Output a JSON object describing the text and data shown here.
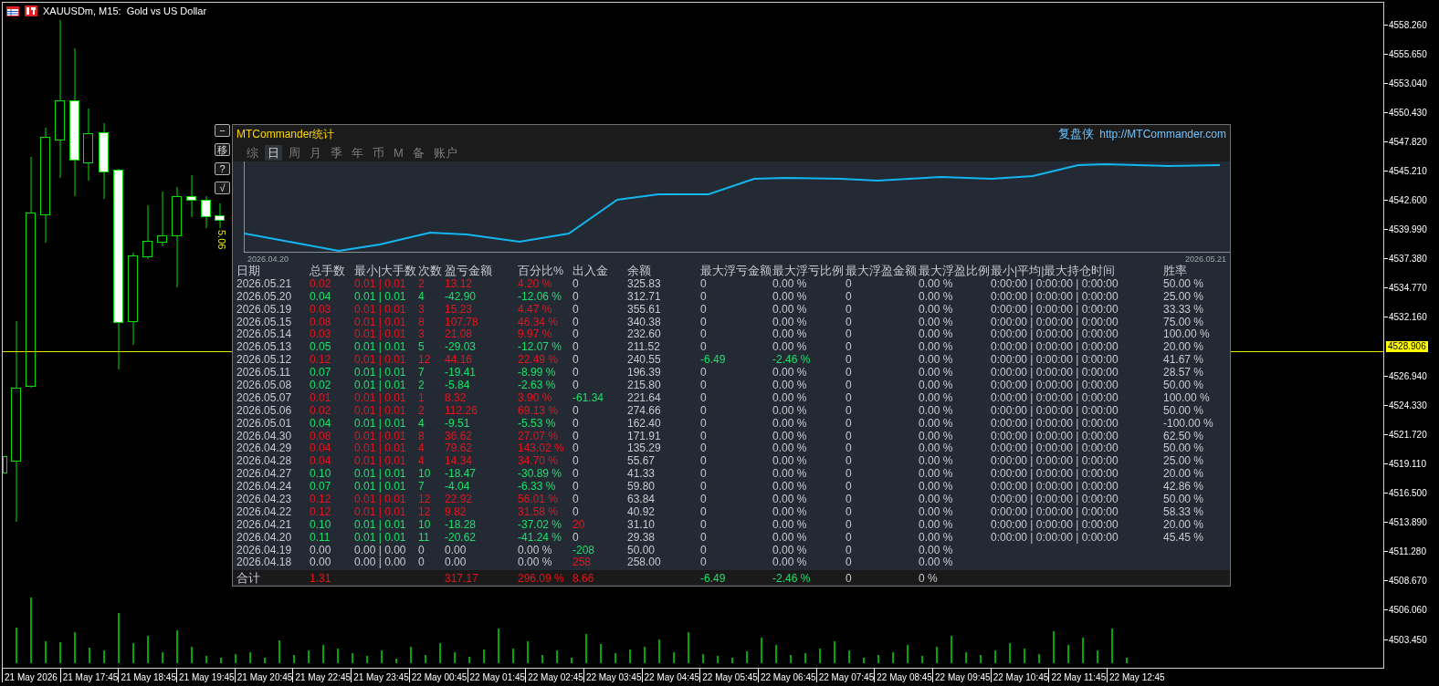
{
  "chart_header": {
    "title": "XAUUSDm, M15:  Gold vs US Dollar"
  },
  "price_marker": "5.06",
  "price_axis": {
    "labels_above": [
      "4558.260",
      "4555.650",
      "4553.040",
      "4550.430",
      "4547.820",
      "4545.210",
      "4542.600",
      "4539.990",
      "4537.380",
      "4534.770",
      "4532.160"
    ],
    "current_price": "4528.906",
    "labels_below": [
      "4526.940",
      "4524.330",
      "4521.720",
      "4519.110",
      "4516.500",
      "4513.890",
      "4511.280",
      "4508.670",
      "4506.060",
      "4503.450"
    ]
  },
  "time_axis": {
    "labels": [
      "21 May 2026",
      "21 May 17:45",
      "21 May 18:45",
      "21 May 19:45",
      "21 May 20:45",
      "21 May 22:45",
      "21 May 23:45",
      "22 May 00:45",
      "22 May 01:45",
      "22 May 02:45",
      "22 May 03:45",
      "22 May 04:45",
      "22 May 05:45",
      "22 May 06:45",
      "22 May 07:45",
      "22 May 08:45",
      "22 May 09:45",
      "22 May 10:45",
      "22 May 11:45",
      "22 May 12:45"
    ]
  },
  "stats_panel": {
    "side_buttons": [
      "−",
      "移",
      "?",
      "√"
    ],
    "title": "MTCommander统计",
    "brand": "复盘侠",
    "link": "http://MTCommander.com",
    "tabs": [
      {
        "label": "综",
        "selected": false
      },
      {
        "label": "日",
        "selected": true
      },
      {
        "label": "周",
        "selected": false
      },
      {
        "label": "月",
        "selected": false
      },
      {
        "label": "季",
        "selected": false
      },
      {
        "label": "年",
        "selected": false
      },
      {
        "label": "币",
        "selected": false
      },
      {
        "label": "M",
        "selected": false
      },
      {
        "label": "备",
        "selected": false
      },
      {
        "label": "账户",
        "selected": false
      }
    ],
    "equity_chart": {
      "start_date": "2026.04.20",
      "end_date": "2026.05.21"
    },
    "table": {
      "columns": [
        "日期",
        "总手数",
        "最小|大手数",
        "次数",
        "盈亏金额",
        "百分比%",
        "出入金",
        "余额",
        "最大浮亏金额",
        "最大浮亏比例",
        "最大浮盈金额",
        "最大浮盈比例",
        "最小|平均|最大持仓时间",
        "胜率"
      ],
      "rows": [
        {
          "cells": [
            "2026.05.21",
            {
              "text": "0.02",
              "color": "#e3161e"
            },
            {
              "text": "0.01 | 0.01",
              "color": "#e3161e"
            },
            {
              "text": "2",
              "color": "#e3161e"
            },
            {
              "text": "13.12",
              "color": "#e3161e"
            },
            {
              "text": "4.20 %",
              "color": "#e3161e"
            },
            "0",
            "325.83",
            "0",
            "0.00 %",
            "0",
            "0.00 %",
            "0:00:00 | 0:00:00 | 0:00:00",
            "50.00 %"
          ]
        },
        {
          "cells": [
            "2026.05.20",
            {
              "text": "0.04",
              "color": "#1fe06c"
            },
            {
              "text": "0.01 | 0.01",
              "color": "#1fe06c"
            },
            {
              "text": "4",
              "color": "#1fe06c"
            },
            {
              "text": "-42.90",
              "color": "#1fe06c"
            },
            {
              "text": "-12.06 %",
              "color": "#1fe06c"
            },
            "0",
            "312.71",
            "0",
            "0.00 %",
            "0",
            "0.00 %",
            "0:00:00 | 0:00:00 | 0:00:00",
            "25.00 %"
          ]
        },
        {
          "cells": [
            "2026.05.19",
            {
              "text": "0.03",
              "color": "#e3161e"
            },
            {
              "text": "0.01 | 0.01",
              "color": "#e3161e"
            },
            {
              "text": "3",
              "color": "#e3161e"
            },
            {
              "text": "15.23",
              "color": "#e3161e"
            },
            {
              "text": "4.47 %",
              "color": "#e3161e"
            },
            "0",
            "355.61",
            "0",
            "0.00 %",
            "0",
            "0.00 %",
            "0:00:00 | 0:00:00 | 0:00:00",
            "33.33 %"
          ]
        },
        {
          "cells": [
            "2026.05.15",
            {
              "text": "0.08",
              "color": "#e3161e"
            },
            {
              "text": "0.01 | 0.01",
              "color": "#e3161e"
            },
            {
              "text": "8",
              "color": "#e3161e"
            },
            {
              "text": "107.78",
              "color": "#e3161e"
            },
            {
              "text": "46.34 %",
              "color": "#e3161e"
            },
            "0",
            "340.38",
            "0",
            "0.00 %",
            "0",
            "0.00 %",
            "0:00:00 | 0:00:00 | 0:00:00",
            "75.00 %"
          ]
        },
        {
          "cells": [
            "2026.05.14",
            {
              "text": "0.03",
              "color": "#e3161e"
            },
            {
              "text": "0.01 | 0.01",
              "color": "#e3161e"
            },
            {
              "text": "3",
              "color": "#e3161e"
            },
            {
              "text": "21.08",
              "color": "#e3161e"
            },
            {
              "text": "9.97 %",
              "color": "#e3161e"
            },
            "0",
            "232.60",
            "0",
            "0.00 %",
            "0",
            "0.00 %",
            "0:00:00 | 0:00:00 | 0:00:00",
            "100.00 %"
          ]
        },
        {
          "cells": [
            "2026.05.13",
            {
              "text": "0.05",
              "color": "#1fe06c"
            },
            {
              "text": "0.01 | 0.01",
              "color": "#1fe06c"
            },
            {
              "text": "5",
              "color": "#1fe06c"
            },
            {
              "text": "-29.03",
              "color": "#1fe06c"
            },
            {
              "text": "-12.07 %",
              "color": "#1fe06c"
            },
            "0",
            "211.52",
            "0",
            "0.00 %",
            "0",
            "0.00 %",
            "0:00:00 | 0:00:00 | 0:00:00",
            "20.00 %"
          ]
        },
        {
          "cells": [
            "2026.05.12",
            {
              "text": "0.12",
              "color": "#e3161e"
            },
            {
              "text": "0.01 | 0.01",
              "color": "#e3161e"
            },
            {
              "text": "12",
              "color": "#e3161e"
            },
            {
              "text": "44.16",
              "color": "#e3161e"
            },
            {
              "text": "22.49 %",
              "color": "#e3161e"
            },
            "0",
            "240.55",
            {
              "text": "-6.49",
              "color": "#1fe06c"
            },
            {
              "text": "-2.46 %",
              "color": "#1fe06c"
            },
            "0",
            "0.00 %",
            "0:00:00 | 0:00:00 | 0:00:00",
            "41.67 %"
          ]
        },
        {
          "cells": [
            "2026.05.11",
            {
              "text": "0.07",
              "color": "#1fe06c"
            },
            {
              "text": "0.01 | 0.01",
              "color": "#1fe06c"
            },
            {
              "text": "7",
              "color": "#1fe06c"
            },
            {
              "text": "-19.41",
              "color": "#1fe06c"
            },
            {
              "text": "-8.99 %",
              "color": "#1fe06c"
            },
            "0",
            "196.39",
            "0",
            "0.00 %",
            "0",
            "0.00 %",
            "0:00:00 | 0:00:00 | 0:00:00",
            "28.57 %"
          ]
        },
        {
          "cells": [
            "2026.05.08",
            {
              "text": "0.02",
              "color": "#1fe06c"
            },
            {
              "text": "0.01 | 0.01",
              "color": "#1fe06c"
            },
            {
              "text": "2",
              "color": "#1fe06c"
            },
            {
              "text": "-5.84",
              "color": "#1fe06c"
            },
            {
              "text": "-2.63 %",
              "color": "#1fe06c"
            },
            "0",
            "215.80",
            "0",
            "0.00 %",
            "0",
            "0.00 %",
            "0:00:00 | 0:00:00 | 0:00:00",
            "50.00 %"
          ]
        },
        {
          "cells": [
            "2026.05.07",
            {
              "text": "0.01",
              "color": "#e3161e"
            },
            {
              "text": "0.01 | 0.01",
              "color": "#e3161e"
            },
            {
              "text": "1",
              "color": "#e3161e"
            },
            {
              "text": "8.32",
              "color": "#e3161e"
            },
            {
              "text": "3.90 %",
              "color": "#e3161e"
            },
            {
              "text": "-61.34",
              "color": "#1fe06c"
            },
            "221.64",
            "0",
            "0.00 %",
            "0",
            "0.00 %",
            "0:00:00 | 0:00:00 | 0:00:00",
            "100.00 %"
          ]
        },
        {
          "cells": [
            "2026.05.06",
            {
              "text": "0.02",
              "color": "#e3161e"
            },
            {
              "text": "0.01 | 0.01",
              "color": "#e3161e"
            },
            {
              "text": "2",
              "color": "#e3161e"
            },
            {
              "text": "112.26",
              "color": "#e3161e"
            },
            {
              "text": "69.13 %",
              "color": "#e3161e"
            },
            "0",
            "274.66",
            "0",
            "0.00 %",
            "0",
            "0.00 %",
            "0:00:00 | 0:00:00 | 0:00:00",
            "50.00 %"
          ]
        },
        {
          "cells": [
            "2026.05.01",
            {
              "text": "0.04",
              "color": "#1fe06c"
            },
            {
              "text": "0.01 | 0.01",
              "color": "#1fe06c"
            },
            {
              "text": "4",
              "color": "#1fe06c"
            },
            {
              "text": "-9.51",
              "color": "#1fe06c"
            },
            {
              "text": "-5.53 %",
              "color": "#1fe06c"
            },
            "0",
            "162.40",
            "0",
            "0.00 %",
            "0",
            "0.00 %",
            "0:00:00 | 0:00:00 | 0:00:00",
            "-100.00 %"
          ]
        },
        {
          "cells": [
            "2026.04.30",
            {
              "text": "0.08",
              "color": "#e3161e"
            },
            {
              "text": "0.01 | 0.01",
              "color": "#e3161e"
            },
            {
              "text": "8",
              "color": "#e3161e"
            },
            {
              "text": "36.62",
              "color": "#e3161e"
            },
            {
              "text": "27.07 %",
              "color": "#e3161e"
            },
            "0",
            "171.91",
            "0",
            "0.00 %",
            "0",
            "0.00 %",
            "0:00:00 | 0:00:00 | 0:00:00",
            "62.50 %"
          ]
        },
        {
          "cells": [
            "2026.04.29",
            {
              "text": "0.04",
              "color": "#e3161e"
            },
            {
              "text": "0.01 | 0.01",
              "color": "#e3161e"
            },
            {
              "text": "4",
              "color": "#e3161e"
            },
            {
              "text": "79.62",
              "color": "#e3161e"
            },
            {
              "text": "143.02 %",
              "color": "#e3161e"
            },
            "0",
            "135.29",
            "0",
            "0.00 %",
            "0",
            "0.00 %",
            "0:00:00 | 0:00:00 | 0:00:00",
            "50.00 %"
          ]
        },
        {
          "cells": [
            "2026.04.28",
            {
              "text": "0.04",
              "color": "#e3161e"
            },
            {
              "text": "0.01 | 0.01",
              "color": "#e3161e"
            },
            {
              "text": "4",
              "color": "#e3161e"
            },
            {
              "text": "14.34",
              "color": "#e3161e"
            },
            {
              "text": "34.70 %",
              "color": "#e3161e"
            },
            "0",
            "55.67",
            "0",
            "0.00 %",
            "0",
            "0.00 %",
            "0:00:00 | 0:00:00 | 0:00:00",
            "25.00 %"
          ]
        },
        {
          "cells": [
            "2026.04.27",
            {
              "text": "0.10",
              "color": "#1fe06c"
            },
            {
              "text": "0.01 | 0.01",
              "color": "#1fe06c"
            },
            {
              "text": "10",
              "color": "#1fe06c"
            },
            {
              "text": "-18.47",
              "color": "#1fe06c"
            },
            {
              "text": "-30.89 %",
              "color": "#1fe06c"
            },
            "0",
            "41.33",
            "0",
            "0.00 %",
            "0",
            "0.00 %",
            "0:00:00 | 0:00:00 | 0:00:00",
            "20.00 %"
          ]
        },
        {
          "cells": [
            "2026.04.24",
            {
              "text": "0.07",
              "color": "#1fe06c"
            },
            {
              "text": "0.01 | 0.01",
              "color": "#1fe06c"
            },
            {
              "text": "7",
              "color": "#1fe06c"
            },
            {
              "text": "-4.04",
              "color": "#1fe06c"
            },
            {
              "text": "-6.33 %",
              "color": "#1fe06c"
            },
            "0",
            "59.80",
            "0",
            "0.00 %",
            "0",
            "0.00 %",
            "0:00:00 | 0:00:00 | 0:00:00",
            "42.86 %"
          ]
        },
        {
          "cells": [
            "2026.04.23",
            {
              "text": "0.12",
              "color": "#e3161e"
            },
            {
              "text": "0.01 | 0.01",
              "color": "#e3161e"
            },
            {
              "text": "12",
              "color": "#e3161e"
            },
            {
              "text": "22.92",
              "color": "#e3161e"
            },
            {
              "text": "56.01 %",
              "color": "#e3161e"
            },
            "0",
            "63.84",
            "0",
            "0.00 %",
            "0",
            "0.00 %",
            "0:00:00 | 0:00:00 | 0:00:00",
            "50.00 %"
          ]
        },
        {
          "cells": [
            "2026.04.22",
            {
              "text": "0.12",
              "color": "#e3161e"
            },
            {
              "text": "0.01 | 0.01",
              "color": "#e3161e"
            },
            {
              "text": "12",
              "color": "#e3161e"
            },
            {
              "text": "9.82",
              "color": "#e3161e"
            },
            {
              "text": "31.58 %",
              "color": "#e3161e"
            },
            "0",
            "40.92",
            "0",
            "0.00 %",
            "0",
            "0.00 %",
            "0:00:00 | 0:00:00 | 0:00:00",
            "58.33 %"
          ]
        },
        {
          "cells": [
            "2026.04.21",
            {
              "text": "0.10",
              "color": "#1fe06c"
            },
            {
              "text": "0.01 | 0.01",
              "color": "#1fe06c"
            },
            {
              "text": "10",
              "color": "#1fe06c"
            },
            {
              "text": "-18.28",
              "color": "#1fe06c"
            },
            {
              "text": "-37.02 %",
              "color": "#1fe06c"
            },
            {
              "text": "20",
              "color": "#e3161e"
            },
            "31.10",
            "0",
            "0.00 %",
            "0",
            "0.00 %",
            "0:00:00 | 0:00:00 | 0:00:00",
            "20.00 %"
          ]
        },
        {
          "cells": [
            "2026.04.20",
            {
              "text": "0.11",
              "color": "#1fe06c"
            },
            {
              "text": "0.01 | 0.01",
              "color": "#1fe06c"
            },
            {
              "text": "11",
              "color": "#1fe06c"
            },
            {
              "text": "-20.62",
              "color": "#1fe06c"
            },
            {
              "text": "-41.24 %",
              "color": "#1fe06c"
            },
            "0",
            "29.38",
            "0",
            "0.00 %",
            "0",
            "0.00 %",
            "0:00:00 | 0:00:00 | 0:00:00",
            "45.45 %"
          ]
        },
        {
          "cells": [
            "2026.04.19",
            "0.00",
            "0.00 | 0.00",
            "0",
            "0.00",
            "0.00 %",
            {
              "text": "-208",
              "color": "#1fe06c"
            },
            "50.00",
            "0",
            "0.00 %",
            "0",
            "0.00 %"
          ]
        },
        {
          "cells": [
            "2026.04.18",
            "0.00",
            "0.00 | 0.00",
            "0",
            "0.00",
            "0.00 %",
            {
              "text": "258",
              "color": "#e3161e"
            },
            "258.00",
            "0",
            "0.00 %",
            "0",
            "0.00 %"
          ]
        }
      ],
      "total": {
        "cells": [
          "合计",
          {
            "text": "1.31",
            "color": "#e3161e"
          },
          null,
          null,
          {
            "text": "317.17",
            "color": "#e3161e"
          },
          {
            "text": "296.09 %",
            "color": "#e3161e"
          },
          {
            "text": "8.66",
            "color": "#e3161e"
          },
          null,
          {
            "text": "-6.49",
            "color": "#1fe06c"
          },
          {
            "text": "-2.46 %",
            "color": "#1fe06c"
          },
          "0",
          "0 %"
        ]
      }
    }
  }
}
